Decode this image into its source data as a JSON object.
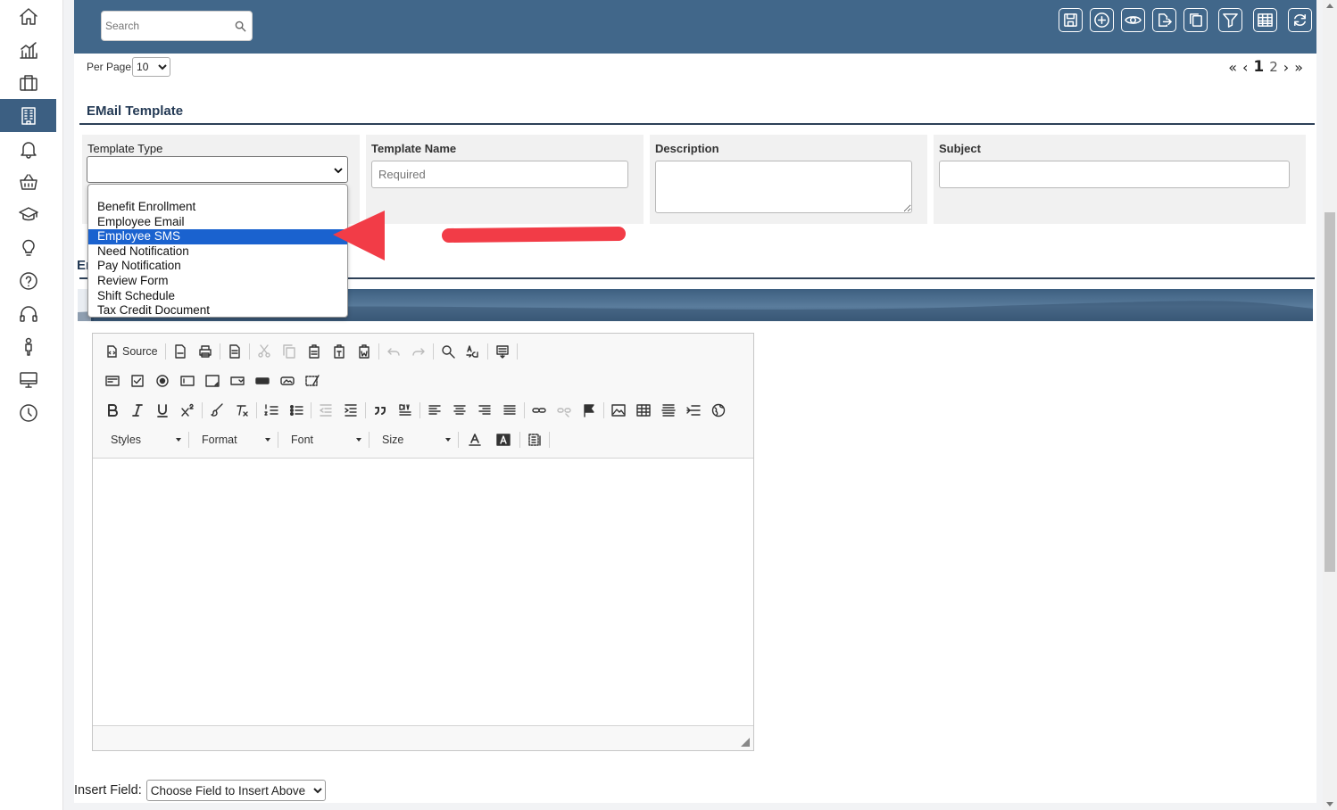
{
  "colors": {
    "header": "#41678a",
    "accent": "#2d4057",
    "selected": "#1a62cf",
    "arrow": "#f23c47"
  },
  "sidebar": {
    "items": [
      {
        "icon": "home-icon"
      },
      {
        "icon": "chart-icon"
      },
      {
        "icon": "briefcase-icon"
      },
      {
        "icon": "building-icon",
        "active": true
      },
      {
        "icon": "bell-icon"
      },
      {
        "icon": "basket-icon"
      },
      {
        "icon": "graduation-cap-icon"
      },
      {
        "icon": "lightbulb-icon"
      },
      {
        "icon": "help-icon"
      },
      {
        "icon": "headset-icon"
      },
      {
        "icon": "person-icon"
      },
      {
        "icon": "monitor-icon"
      },
      {
        "icon": "clock-icon"
      }
    ]
  },
  "toolbar": {
    "search_placeholder": "Search",
    "buttons": [
      "save-icon",
      "add-icon",
      "view-icon",
      "export-icon",
      "copy-icon",
      "filter-icon",
      "grid-icon",
      "refresh-icon"
    ]
  },
  "paging": {
    "per_page_label": "Per Page",
    "per_page_value": "10",
    "first": "«",
    "prev": "‹",
    "current": "1",
    "next_page": "2",
    "next": "›",
    "last": "»"
  },
  "form": {
    "title": "EMail Template",
    "template_type_label": "Template Type",
    "template_name_label": "Template Name",
    "template_name_placeholder": "Required",
    "description_label": "Description",
    "subject_label": "Subject",
    "dropdown_options": [
      "Benefit Enrollment",
      "Employee Email",
      "Employee SMS",
      "Need Notification",
      "Pay Notification",
      "Review Form",
      "Shift Schedule",
      "Tax Credit Document"
    ],
    "selected_option": "Employee SMS"
  },
  "section2": {
    "title_partial": "Er"
  },
  "editor": {
    "source_label": "Source",
    "styles_label": "Styles",
    "format_label": "Format",
    "font_label": "Font",
    "size_label": "Size"
  },
  "insert_field": {
    "label": "Insert Field:",
    "value": "Choose Field to Insert Above"
  }
}
